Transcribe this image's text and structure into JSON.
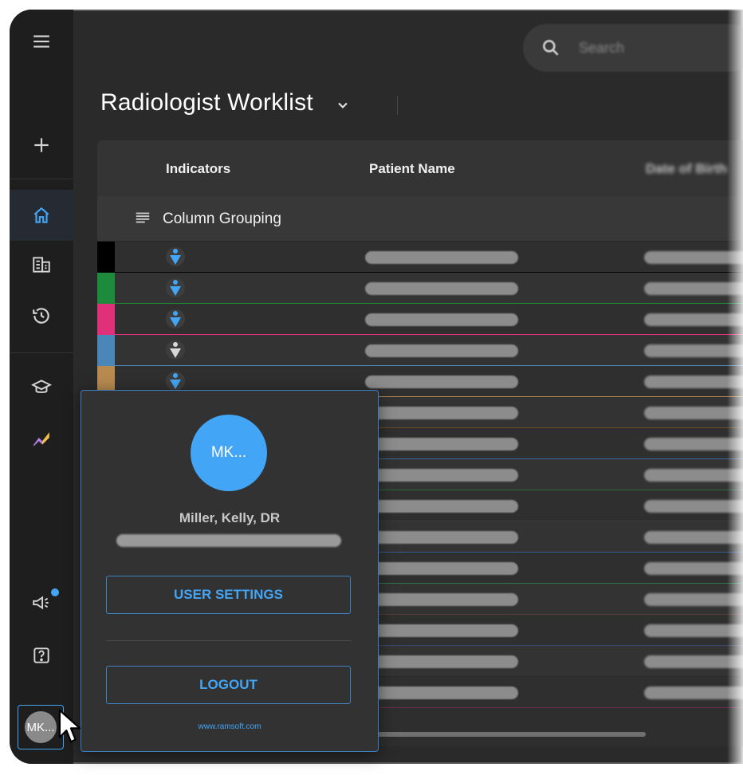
{
  "page": {
    "title": "Radiologist Worklist"
  },
  "search": {
    "placeholder": "Search"
  },
  "grid": {
    "columns": [
      "Indicators",
      "Patient Name",
      "Date of Birth"
    ],
    "grouping_label": "Column Grouping",
    "row_colors": [
      "#000000",
      "#1e8a3c",
      "#e0307a",
      "#4a86b8",
      "#b88a50",
      "#6a4a2a",
      "#3a6a9a",
      "#2a6a3a",
      "#3a3a3a",
      "#3a5a8a",
      "#2a7a4a",
      "#5a3a3a",
      "#3a4a6a",
      "#2a2a2a",
      "#6a2a4a"
    ]
  },
  "user_popup": {
    "avatar_initials": "MK...",
    "name": "Miller, Kelly, DR",
    "settings_label": "USER SETTINGS",
    "logout_label": "LOGOUT",
    "website": "www.ramsoft.com"
  },
  "sidebar": {
    "avatar_initials": "MK..."
  },
  "colors": {
    "accent": "#42a5f5",
    "background": "#2a2a2a",
    "sidebar": "#1e1e1e"
  }
}
